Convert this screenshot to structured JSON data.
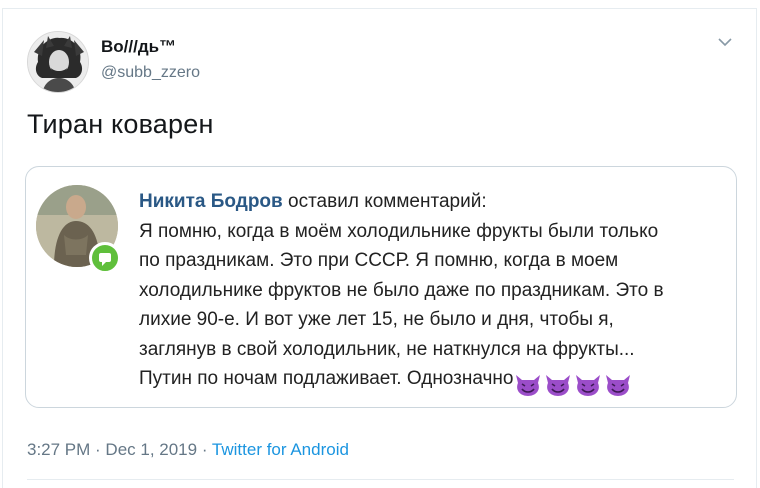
{
  "user": {
    "display_name": "Во///дь™",
    "handle": "@subb_zzero"
  },
  "tweet": {
    "text": "Тиран коварен"
  },
  "quoted": {
    "author": "Никита Бодров",
    "action": "оставил комментарий:",
    "line1": "Я помню, когда в моём холодильнике фрукты были только",
    "line2": "по праздникам. Это при СССР. Я помню, когда в моем",
    "line3": "холодильнике фруктов не было даже по праздникам. Это в",
    "line4": "лихие 90-е. И вот уже лет 15, не было и дня, чтобы я,",
    "line5": "заглянув в свой холодильник, не наткнулся на фрукты...",
    "line6": "Путин по ночам подлаживает. Однозначно",
    "emoji_icons": [
      "smiling-imp-icon",
      "smiling-imp-icon",
      "smiling-imp-icon",
      "smiling-imp-icon"
    ]
  },
  "meta": {
    "time": "3:27 PM",
    "sep1": " · ",
    "date": "Dec 1, 2019",
    "sep2": " · ",
    "source": "Twitter for Android"
  },
  "colors": {
    "handle_gray": "#657786",
    "link_blue": "#1b95e0",
    "vk_author_blue": "#2a5885",
    "comment_badge_green": "#5fbf3b",
    "emoji_purple": "#9b4dc9"
  }
}
